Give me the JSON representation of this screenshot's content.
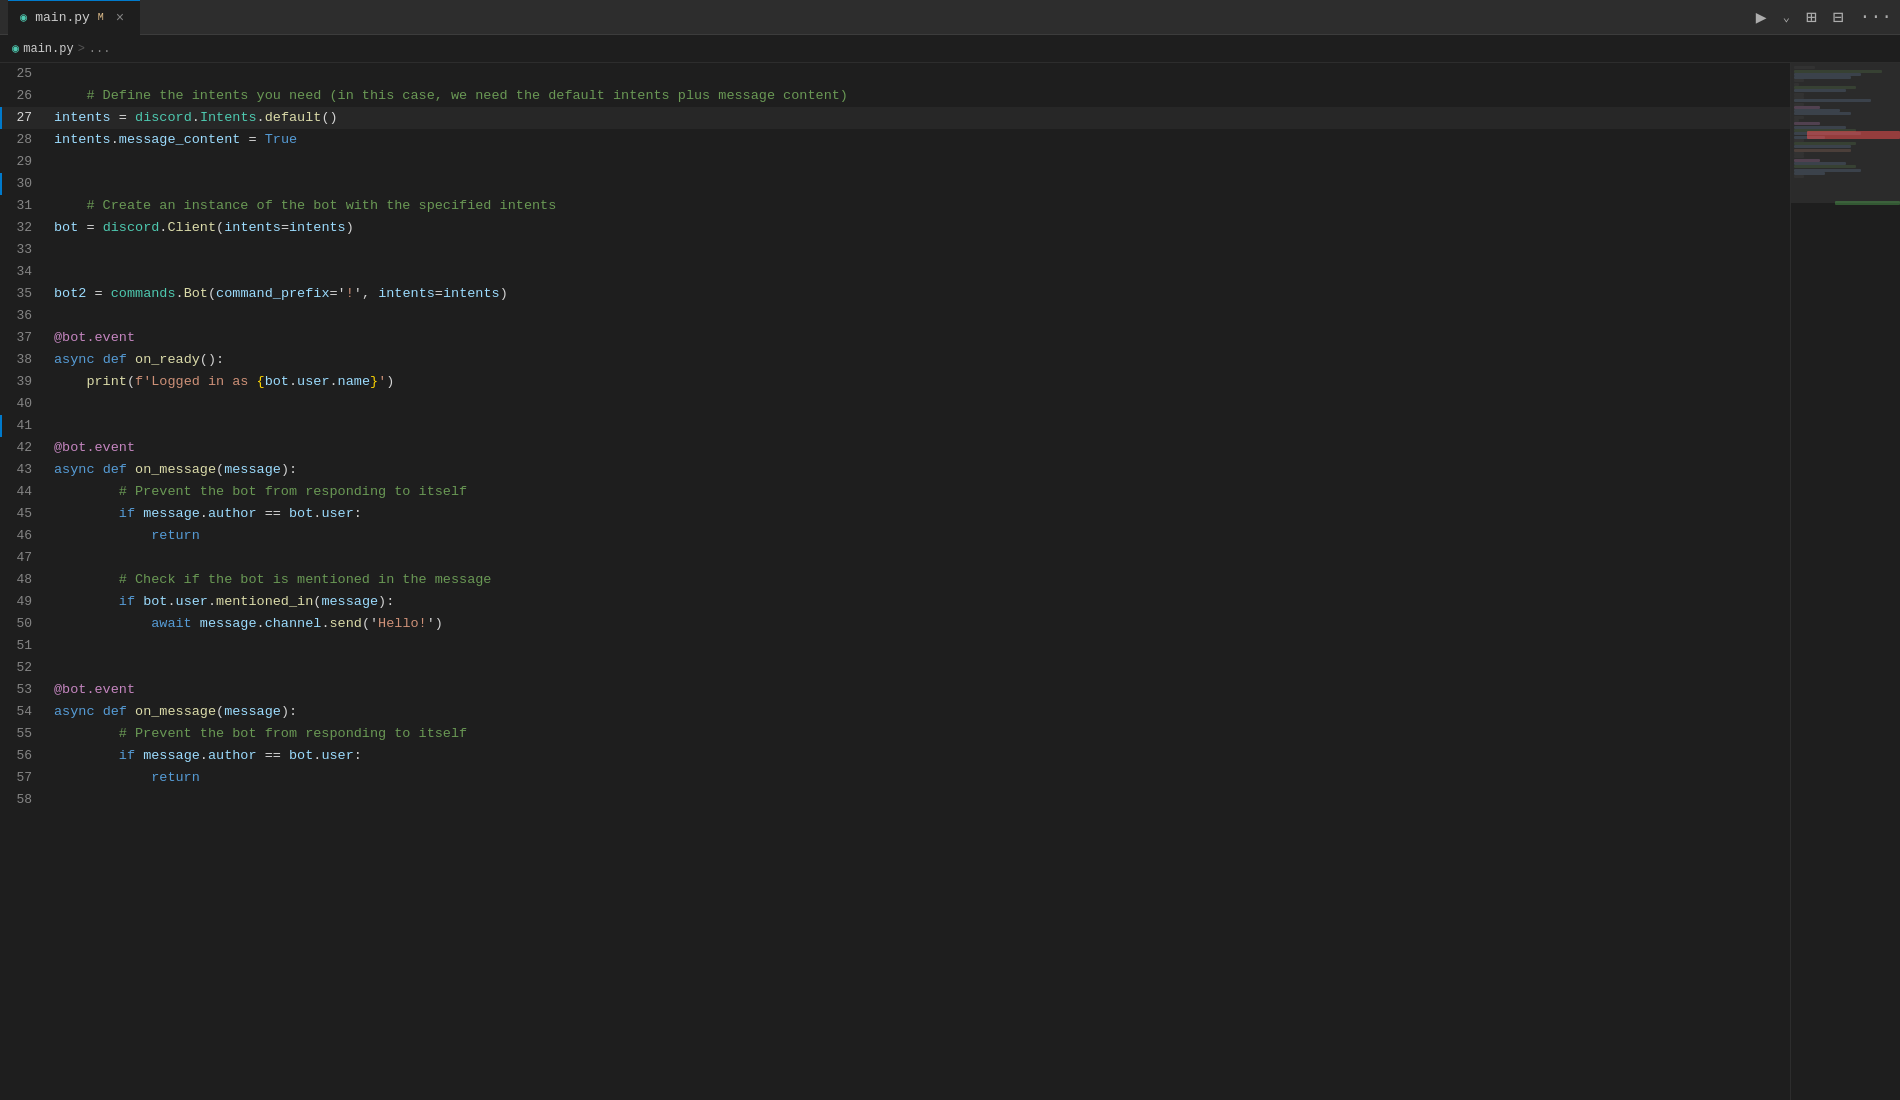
{
  "titleBar": {
    "tab": {
      "icon": "◉",
      "name": "main.py",
      "modified": "M",
      "close": "×"
    },
    "icons": {
      "run": "▶",
      "runMenu": "⌄",
      "remote": "⊞",
      "layout": "⊟",
      "more": "···"
    }
  },
  "breadcrumb": {
    "file": "main.py",
    "sep": ">",
    "rest": "..."
  },
  "lines": [
    {
      "num": 25,
      "content": "",
      "type": "empty"
    },
    {
      "num": 26,
      "content": "    <comment># Define the intents you need (in this case, we need the default intents plus message content)</comment>",
      "type": "comment"
    },
    {
      "num": 27,
      "content": "    <var>intents</var> <op>=</op> <cls>discord</cls><op>.</op><cls>Intents</cls><op>.</op><fn>default</fn><op>()</op>",
      "type": "code",
      "active": true
    },
    {
      "num": 28,
      "content": "    <var>intents</var><op>.</op><attr>message_content</attr> <op>=</op> <kw>True</kw>",
      "type": "code"
    },
    {
      "num": 29,
      "content": "",
      "type": "empty"
    },
    {
      "num": 30,
      "content": "",
      "type": "empty",
      "cursor": true
    },
    {
      "num": 31,
      "content": "    <comment># Create an instance of the bot with the specified intents</comment>",
      "type": "comment"
    },
    {
      "num": 32,
      "content": "    <var>bot</var> <op>=</op> <cls>discord</cls><op>.</op><fn>Client</fn><op>(</op><attr>intents</attr><op>=</op><var>intents</var><op>)</op>",
      "type": "code"
    },
    {
      "num": 33,
      "content": "",
      "type": "empty"
    },
    {
      "num": 34,
      "content": "",
      "type": "empty"
    },
    {
      "num": 35,
      "content": "    <var>bot2</var> <op>=</op> <cls>commands</cls><op>.</op><fn>Bot</fn><op>(</op><attr>command_prefix</attr><op>='</op><str>!</str><op>',</op> <attr>intents</attr><op>=</op><var>intents</var><op>)</op>",
      "type": "code"
    },
    {
      "num": 36,
      "content": "",
      "type": "empty"
    },
    {
      "num": 37,
      "content": "    <dec>@bot.event</dec>",
      "type": "decorator"
    },
    {
      "num": 38,
      "content": "    <kw>async</kw> <kw>def</kw> <fn>on_ready</fn><op>():</op>",
      "type": "code"
    },
    {
      "num": 39,
      "content": "        <fn>print</fn><op>(</op><str>f'Logged in as </str><brace>{</brace><var>bot</var><op>.</op><attr>user</attr><op>.</op><attr>name</attr><brace>}</brace><str>'</str><op>)</op>",
      "type": "code"
    },
    {
      "num": 40,
      "content": "",
      "type": "empty"
    },
    {
      "num": 41,
      "content": "",
      "type": "empty",
      "cursor": true
    },
    {
      "num": 42,
      "content": "    <dec>@bot.event</dec>",
      "type": "decorator"
    },
    {
      "num": 43,
      "content": "    <kw>async</kw> <kw>def</kw> <fn>on_message</fn><op>(</op><param>message</param><op>):</op>",
      "type": "code"
    },
    {
      "num": 44,
      "content": "        <comment># Prevent the bot from responding to itself</comment>",
      "type": "comment"
    },
    {
      "num": 45,
      "content": "        <kw>if</kw> <var>message</var><op>.</op><attr>author</attr> <op>==</op> <var>bot</var><op>.</op><attr>user</attr><op>:</op>",
      "type": "code"
    },
    {
      "num": 46,
      "content": "            <kw>return</kw>",
      "type": "code"
    },
    {
      "num": 47,
      "content": "",
      "type": "empty"
    },
    {
      "num": 48,
      "content": "        <comment># Check if the bot is mentioned in the message</comment>",
      "type": "comment"
    },
    {
      "num": 49,
      "content": "        <kw>if</kw> <var>bot</var><op>.</op><attr>user</attr><op>.</op><fn>mentioned_in</fn><op>(</op><var>message</var><op>):</op>",
      "type": "code"
    },
    {
      "num": 50,
      "content": "            <kw>await</kw> <var>message</var><op>.</op><attr>channel</attr><op>.</op><fn>send</fn><op>('</op><str>Hello!</str><op>')</op>",
      "type": "code"
    },
    {
      "num": 51,
      "content": "",
      "type": "empty"
    },
    {
      "num": 52,
      "content": "",
      "type": "empty"
    },
    {
      "num": 53,
      "content": "    <dec>@bot.event</dec>",
      "type": "decorator"
    },
    {
      "num": 54,
      "content": "    <kw>async</kw> <kw>def</kw> <fn>on_message</fn><op>(</op><param>message</param><op>):</op>",
      "type": "code"
    },
    {
      "num": 55,
      "content": "        <comment># Prevent the bot from responding to itself</comment>",
      "type": "comment"
    },
    {
      "num": 56,
      "content": "        <kw>if</kw> <var>message</var><op>.</op><attr>author</attr> <op>==</op> <var>bot</var><op>.</op><attr>user</attr><op>:</op>",
      "type": "code"
    },
    {
      "num": 57,
      "content": "            <kw>return</kw>",
      "type": "code"
    },
    {
      "num": 58,
      "content": "",
      "type": "empty"
    }
  ],
  "minimap": {
    "viewportTop": 0,
    "viewportHeight": 140
  }
}
